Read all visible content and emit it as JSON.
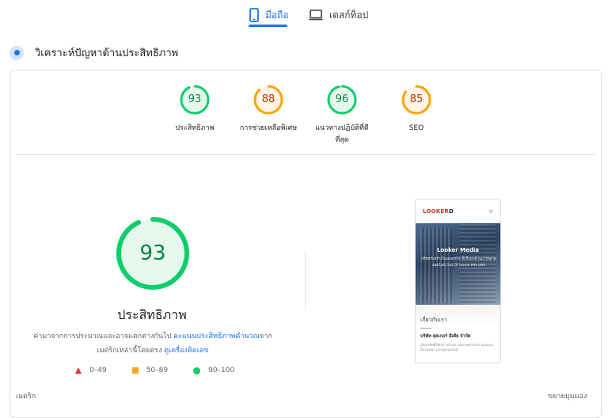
{
  "tabs": {
    "mobile_label": "มือถือ",
    "desktop_label": "เดสก์ท็อป"
  },
  "section": {
    "title": "วิเคราะห์ปัญหาด้านประสิทธิภาพ"
  },
  "scores": [
    {
      "value": "93",
      "label": "ประสิทธิภาพ",
      "fraction": 0.93,
      "color": "#0cce6b"
    },
    {
      "value": "88",
      "label": "การช่วยเหลือพิเศษ",
      "fraction": 0.88,
      "color": "#ffa400"
    },
    {
      "value": "96",
      "label_line1": "แนวทางปฏิบัติที่ดี",
      "label_line2": "ที่สุด",
      "fraction": 0.96,
      "color": "#0cce6b"
    },
    {
      "value": "85",
      "label": "SEO",
      "fraction": 0.85,
      "color": "#ffa400"
    }
  ],
  "main_gauge": {
    "value": "93",
    "fraction": 0.93,
    "title": "ประสิทธิภาพ",
    "desc_part1": "ค่ามาจากการประมาณและอาจแตกต่างกันไป ",
    "desc_link1": "คะแนนประสิทธิภาพคำนวณ",
    "desc_part2": "จาก",
    "desc_part3": "เมตริกเหล่านี้โดยตรง ",
    "desc_link2": "ดูเครื่องคิดเลข"
  },
  "legend": [
    {
      "label": "0–49",
      "shape": "triangle",
      "color": "#ea3333"
    },
    {
      "label": "50–89",
      "shape": "square",
      "color": "#f5a623"
    },
    {
      "label": "90–100",
      "shape": "circle",
      "color": "#0cce6b"
    }
  ],
  "preview": {
    "logo_red": "LOOKER",
    "logo_dark": "D",
    "hero_title": "Looker Media",
    "hero_sub": "บริษัทรับสร้างโมเดลธุรกิจ ที่ปรึกษาด้านการตลาดออนไลน์ Out Of Home ครบวงจร",
    "about_title": "เกี่ยวกับเรา",
    "company": "บริษัท ลุคเกอร์ มีเดีย จำกัด",
    "body_text": "เป็นบริษัทที่ให้บริการด้านการตลาดครบวงจร ออกแบบสื่อโฆษณา และดูแลแบรนด์"
  },
  "footer": {
    "metrics_label": "เมตริก",
    "expand_label": "ขยายมุมมอง"
  }
}
